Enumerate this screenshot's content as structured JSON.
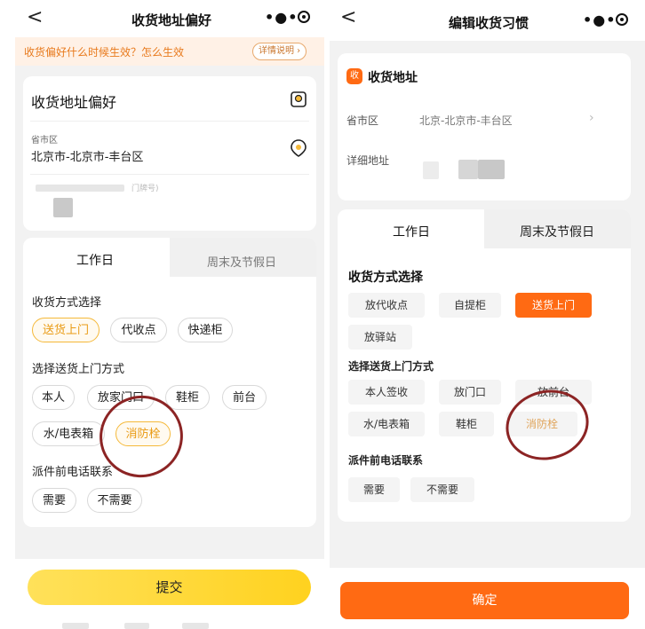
{
  "left": {
    "nav": {
      "back": "<",
      "title": "收货地址偏好"
    },
    "notice": {
      "text": "收货偏好什么时候生效？怎么生效",
      "button": "详情说明 ›"
    },
    "address_card": {
      "title": "收货地址偏好",
      "region_label": "省市区",
      "region_value": "北京市-北京市-丰台区",
      "detail_hint": "门牌号)"
    },
    "tabs": {
      "active": "工作日",
      "inactive": "周末及节假日"
    },
    "method_section": {
      "title": "收货方式选择",
      "options": [
        "送货上门",
        "代收点",
        "快递柜"
      ]
    },
    "door_section": {
      "title": "选择送货上门方式",
      "options": [
        "本人",
        "放家门口",
        "鞋柜",
        "前台",
        "水/电表箱",
        "消防栓"
      ]
    },
    "call_section": {
      "title": "派件前电话联系",
      "options": [
        "需要",
        "不需要"
      ]
    },
    "submit": "提交"
  },
  "right": {
    "nav": {
      "back": "<",
      "title": "编辑收货习惯"
    },
    "address_card": {
      "badge": "收",
      "title": "收货地址",
      "region_label": "省市区",
      "region_value": "北京-北京市-丰台区",
      "detail_label": "详细地址"
    },
    "tabs": {
      "active": "工作日",
      "inactive": "周末及节假日"
    },
    "method_section": {
      "title": "收货方式选择",
      "options": [
        "放代收点",
        "自提柜",
        "送货上门",
        "放驿站"
      ]
    },
    "door_section": {
      "title": "选择送货上门方式",
      "options": [
        "本人签收",
        "放门口",
        "放前台",
        "水/电表箱",
        "鞋柜",
        "消防栓"
      ]
    },
    "call_section": {
      "title": "派件前电话联系",
      "options": [
        "需要",
        "不需要"
      ]
    },
    "confirm": "确定"
  },
  "colors": {
    "accent_yellow": "#f5b93a",
    "accent_orange": "#ff6a13",
    "annotation_red": "#8c2424"
  }
}
